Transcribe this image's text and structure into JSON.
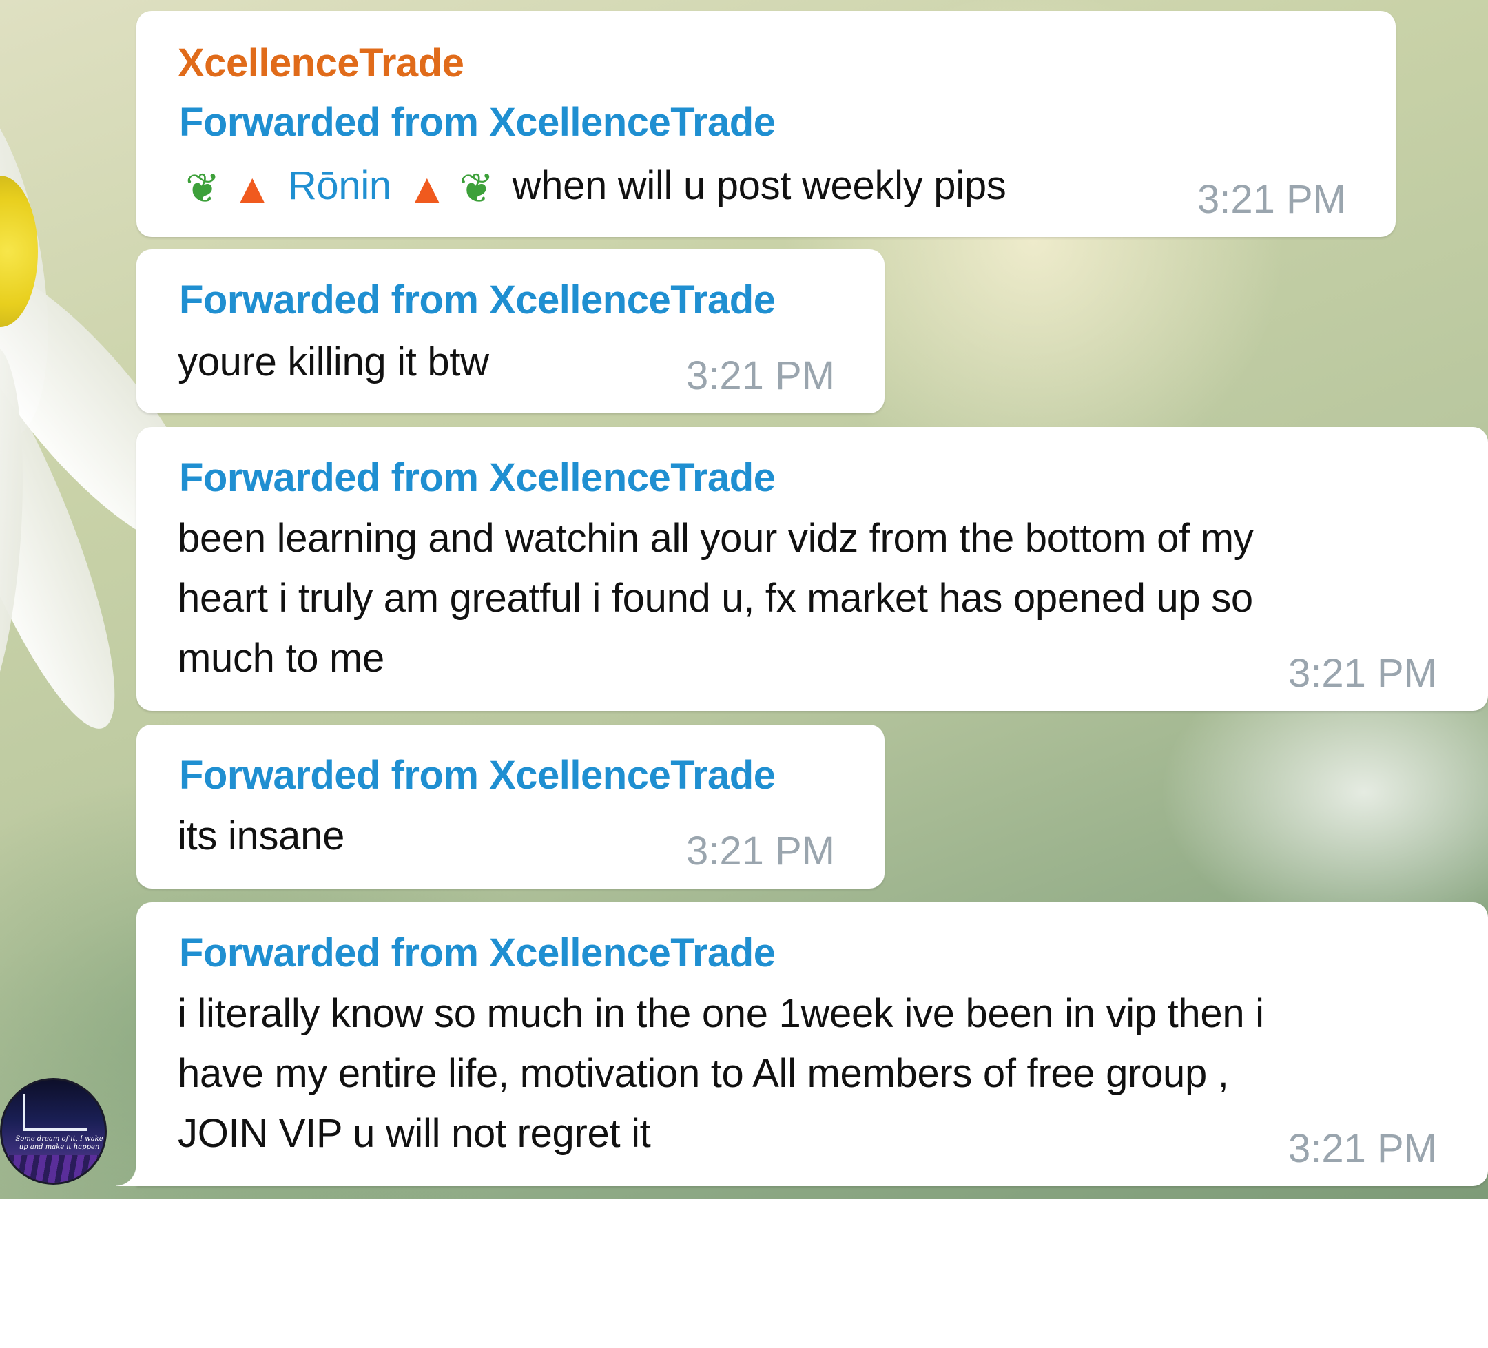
{
  "chat": {
    "messages": [
      {
        "sender": "XcellenceTrade",
        "forwarded": "Forwarded from XcellenceTrade",
        "mention": "Rōnin",
        "text": "when will u post weekly pips",
        "time": "3:21 PM",
        "emojis": [
          "herb-icon",
          "fire-icon",
          "fire-icon",
          "herb-icon"
        ]
      },
      {
        "forwarded": "Forwarded from XcellenceTrade",
        "text": "youre killing it btw",
        "time": "3:21 PM"
      },
      {
        "forwarded": "Forwarded from XcellenceTrade",
        "lines": [
          "been learning and watchin all your vidz from the bottom of my",
          "heart i truly am greatful i found u, fx market has opened up so",
          "much to me"
        ],
        "time": "3:21 PM"
      },
      {
        "forwarded": "Forwarded from XcellenceTrade",
        "text": "its insane",
        "time": "3:21 PM"
      },
      {
        "forwarded": "Forwarded from XcellenceTrade",
        "lines": [
          "i literally know so much in the one 1week ive been in vip then i",
          "have my entire life, motivation to All members of free group ,",
          "JOIN VIP u will not regret it"
        ],
        "time": "3:21 PM"
      }
    ],
    "avatar": {
      "caption": "Some dream of it, I wake up and make it happen"
    }
  },
  "colors": {
    "sender": "#e06b1a",
    "forwarded": "#1f8fd1",
    "time": "#9aa5ae",
    "bubble": "#ffffff"
  }
}
